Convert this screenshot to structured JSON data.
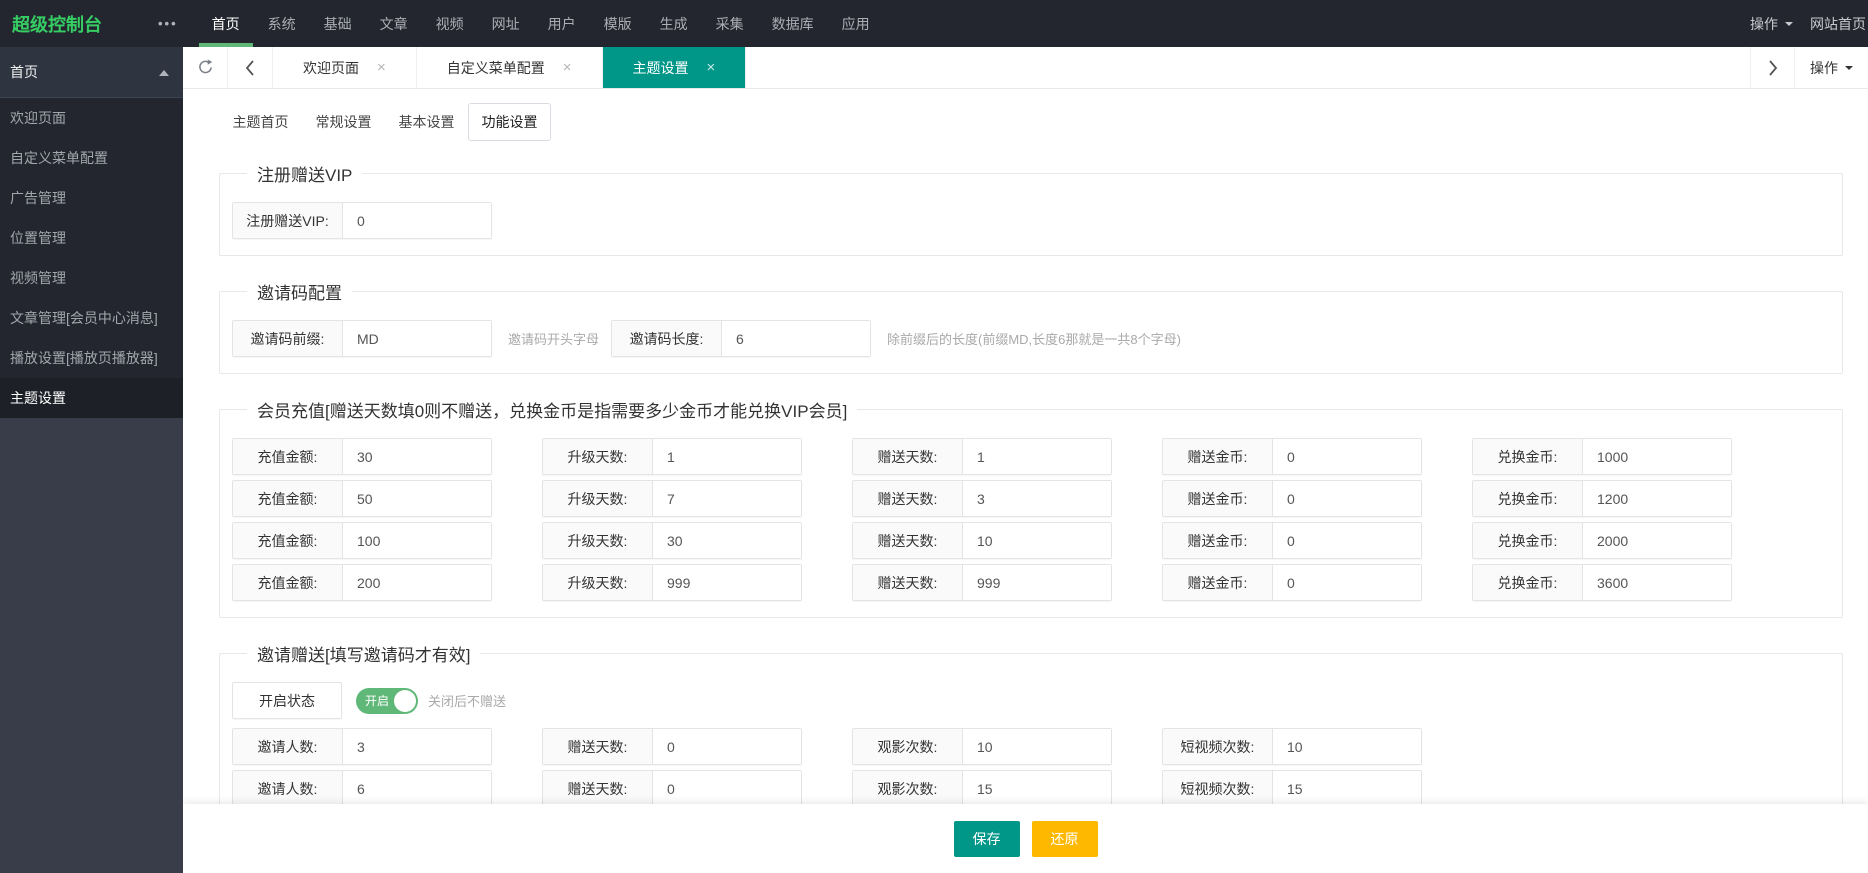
{
  "topbar": {
    "logo": "超级控制台",
    "dots": "•••",
    "nav": [
      "首页",
      "系统",
      "基础",
      "文章",
      "视频",
      "网址",
      "用户",
      "模版",
      "生成",
      "采集",
      "数据库",
      "应用"
    ],
    "active_nav": "首页",
    "action_label": "操作",
    "site_home_label": "网站首页"
  },
  "sidebar": {
    "header": "首页",
    "items": [
      "欢迎页面",
      "自定义菜单配置",
      "广告管理",
      "位置管理",
      "视频管理",
      "文章管理[会员中心消息]",
      "播放设置[播放页播放器]",
      "主题设置"
    ],
    "active_item": "主题设置"
  },
  "tabbar": {
    "tabs": [
      "欢迎页面",
      "自定义菜单配置",
      "主题设置"
    ],
    "active_tab": "主题设置",
    "close_glyph": "×",
    "action_label": "操作"
  },
  "subtabs": {
    "tabs": [
      "主题首页",
      "常规设置",
      "基本设置",
      "功能设置"
    ],
    "active": "功能设置"
  },
  "sections": [
    {
      "legend": "注册赠送VIP",
      "rows": [
        [
          {
            "label": "注册赠送VIP:",
            "value": "0"
          }
        ]
      ]
    },
    {
      "legend": "邀请码配置",
      "rows": [
        [
          {
            "label": "邀请码前缀:",
            "value": "MD",
            "hint": "邀请码开头字母"
          },
          {
            "label": "邀请码长度:",
            "value": "6",
            "hint": "除前缀后的长度(前缀MD,长度6那就是一共8个字母)"
          }
        ]
      ]
    },
    {
      "legend": "会员充值[赠送天数填0则不赠送，兑换金币是指需要多少金币才能兑换VIP会员]",
      "rows": [
        [
          {
            "label": "充值金额:",
            "value": "30"
          },
          {
            "label": "升级天数:",
            "value": "1"
          },
          {
            "label": "赠送天数:",
            "value": "1"
          },
          {
            "label": "赠送金币:",
            "value": "0"
          },
          {
            "label": "兑换金币:",
            "value": "1000"
          }
        ],
        [
          {
            "label": "充值金额:",
            "value": "50"
          },
          {
            "label": "升级天数:",
            "value": "7"
          },
          {
            "label": "赠送天数:",
            "value": "3"
          },
          {
            "label": "赠送金币:",
            "value": "0"
          },
          {
            "label": "兑换金币:",
            "value": "1200"
          }
        ],
        [
          {
            "label": "充值金额:",
            "value": "100"
          },
          {
            "label": "升级天数:",
            "value": "30"
          },
          {
            "label": "赠送天数:",
            "value": "10"
          },
          {
            "label": "赠送金币:",
            "value": "0"
          },
          {
            "label": "兑换金币:",
            "value": "2000"
          }
        ],
        [
          {
            "label": "充值金额:",
            "value": "200"
          },
          {
            "label": "升级天数:",
            "value": "999"
          },
          {
            "label": "赠送天数:",
            "value": "999"
          },
          {
            "label": "赠送金币:",
            "value": "0"
          },
          {
            "label": "兑换金币:",
            "value": "3600"
          }
        ]
      ]
    },
    {
      "legend": "邀请赠送[填写邀请码才有效]",
      "toggle": {
        "label": "开启状态",
        "state": "开启",
        "on": true,
        "hint": "关闭后不赠送"
      },
      "rows": [
        [
          {
            "label": "邀请人数:",
            "value": "3"
          },
          {
            "label": "赠送天数:",
            "value": "0"
          },
          {
            "label": "观影次数:",
            "value": "10"
          },
          {
            "label": "短视频次数:",
            "value": "10"
          }
        ],
        [
          {
            "label": "邀请人数:",
            "value": "6"
          },
          {
            "label": "赠送天数:",
            "value": "0"
          },
          {
            "label": "观影次数:",
            "value": "15"
          },
          {
            "label": "短视频次数:",
            "value": "15"
          }
        ]
      ]
    }
  ],
  "footer": {
    "save_label": "保存",
    "reset_label": "还原"
  },
  "colors": {
    "theme_teal": "#009688",
    "toggle_green": "#5FB878",
    "logo_green": "#36CE64",
    "warn_yellow": "#FFB800",
    "dark_bar": "#23262E",
    "sidebar_base": "#393D49"
  }
}
